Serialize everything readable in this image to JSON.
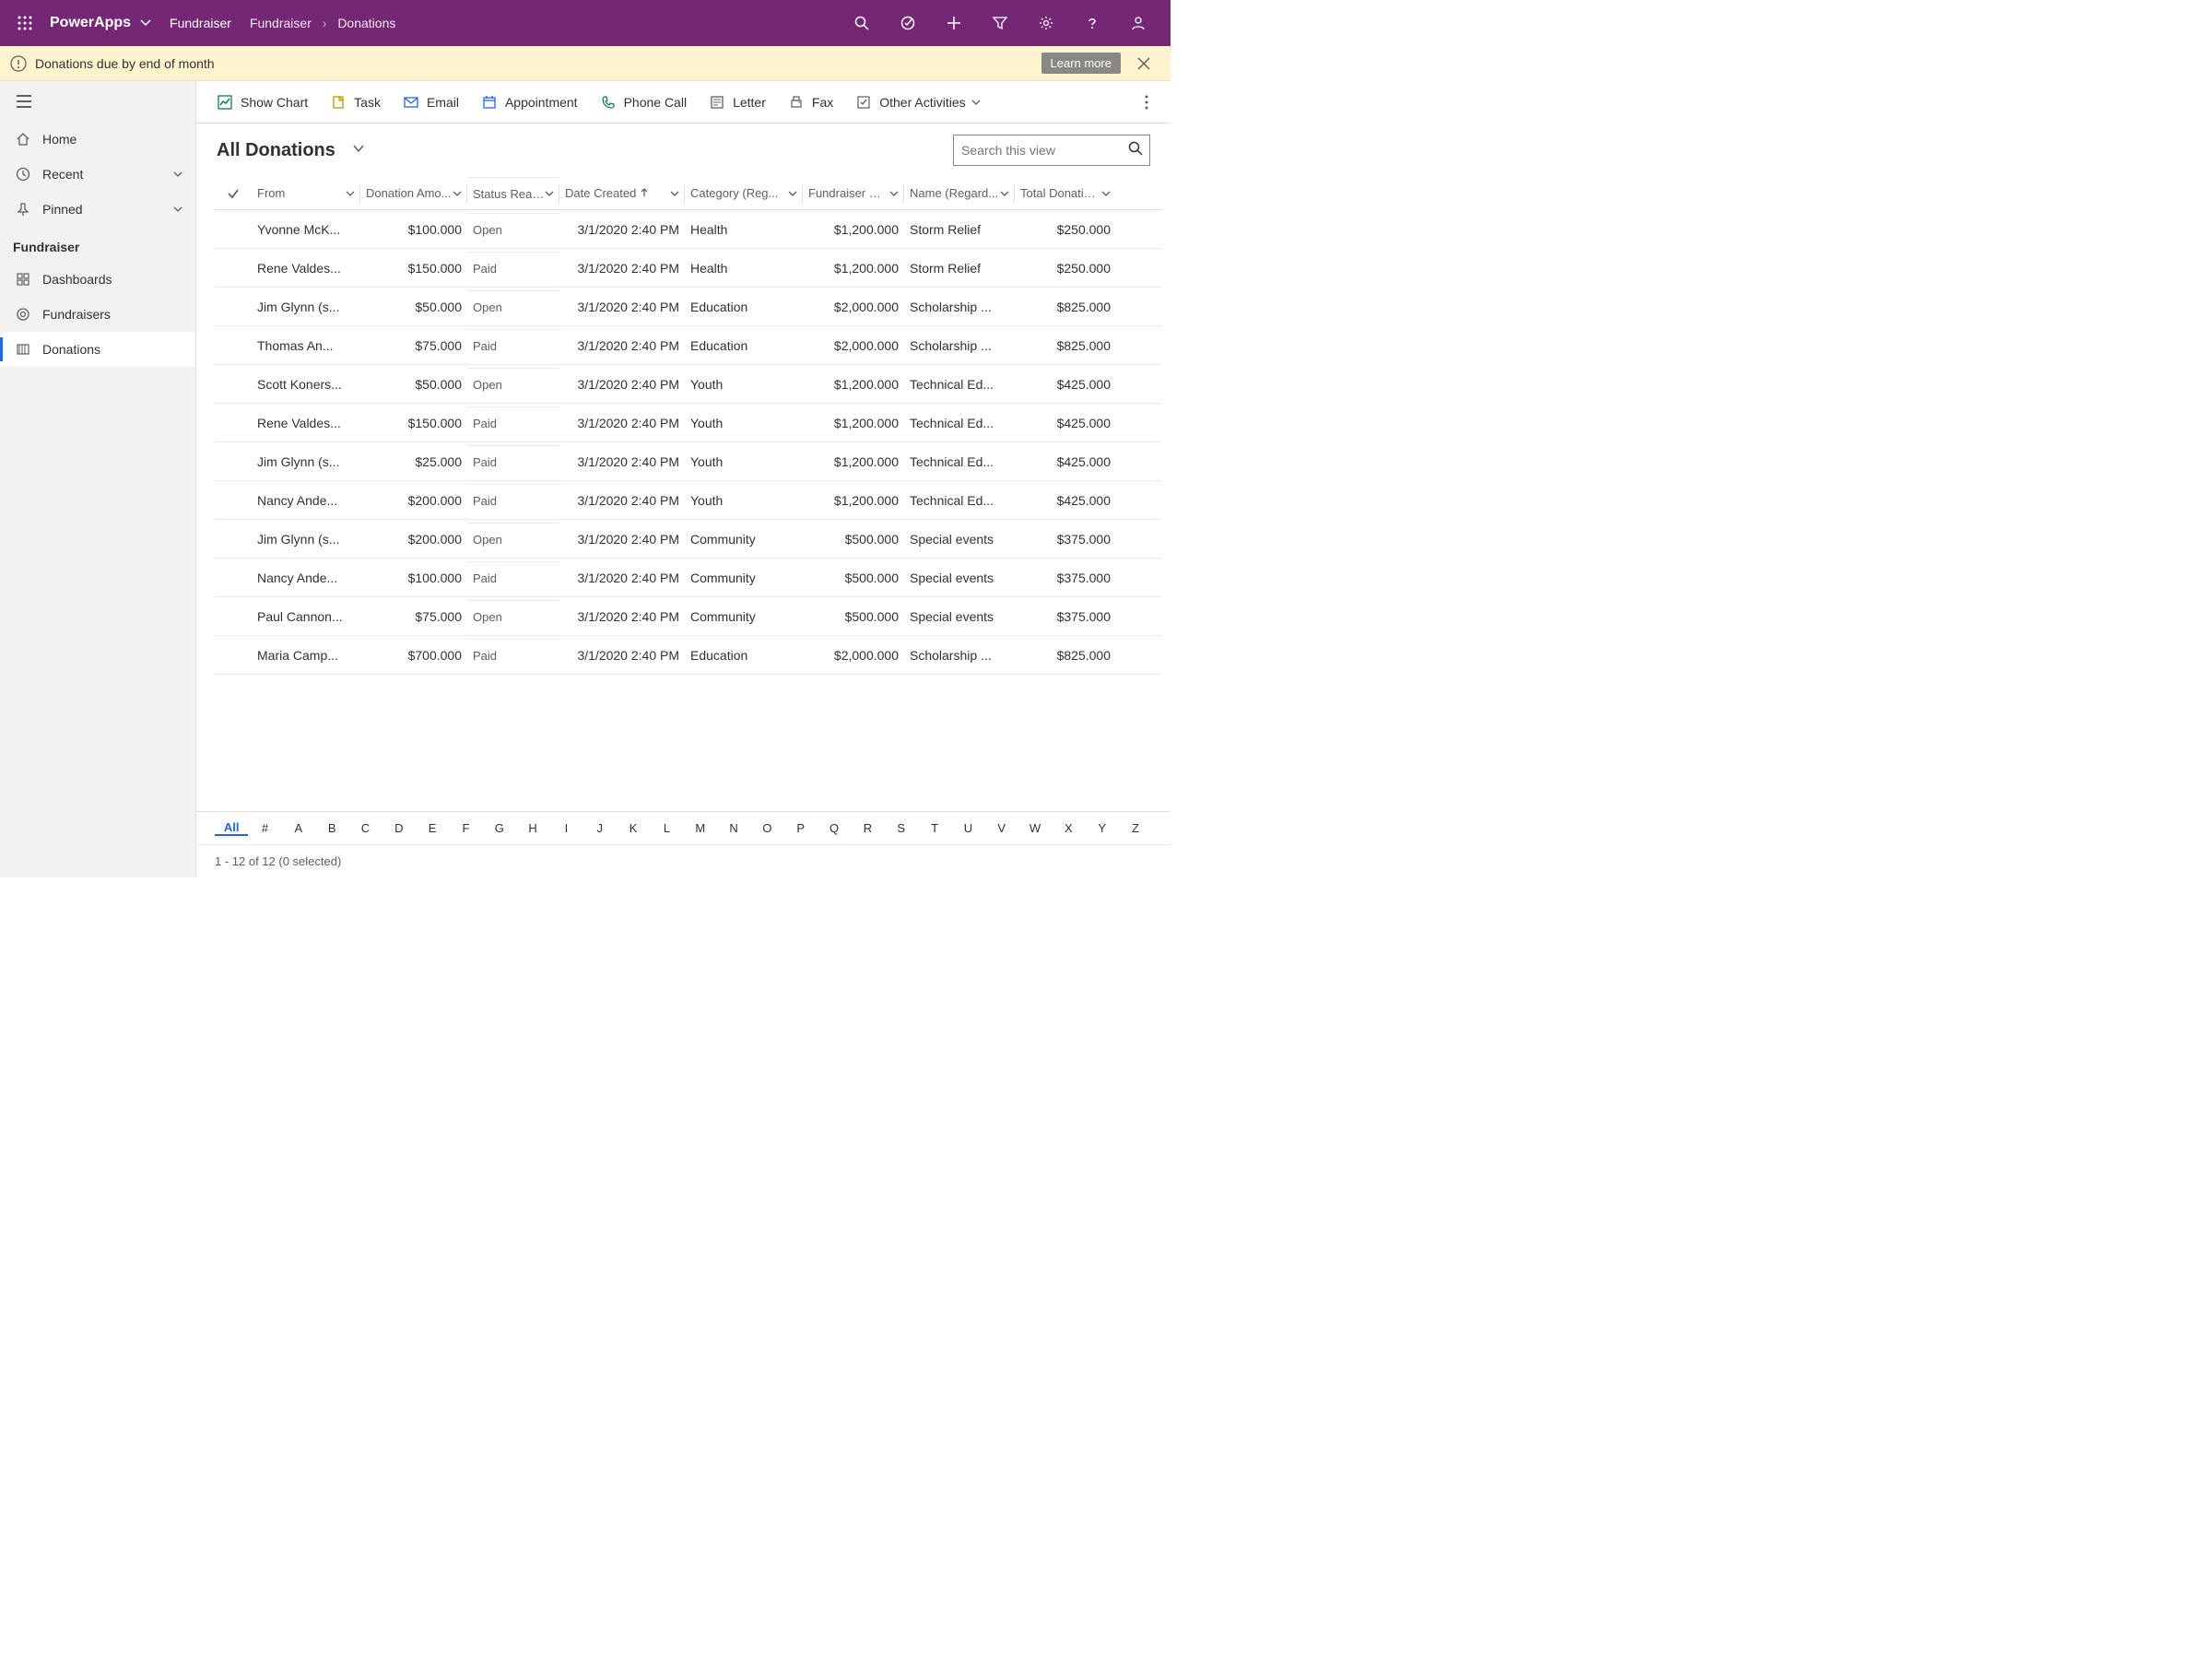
{
  "header": {
    "app_title": "PowerApps",
    "sitemap": "Fundraiser",
    "breadcrumb": [
      "Fundraiser",
      "Donations"
    ]
  },
  "notif": {
    "text": "Donations due by end of month",
    "learn_more": "Learn more"
  },
  "sidebar": {
    "top": [
      {
        "icon": "home",
        "label": "Home"
      },
      {
        "icon": "clock",
        "label": "Recent",
        "chev": true
      },
      {
        "icon": "pin",
        "label": "Pinned",
        "chev": true
      }
    ],
    "group_title": "Fundraiser",
    "items": [
      {
        "icon": "dash",
        "label": "Dashboards"
      },
      {
        "icon": "fund",
        "label": "Fundraisers"
      },
      {
        "icon": "don",
        "label": "Donations",
        "selected": true
      }
    ]
  },
  "cmdbar": [
    {
      "icon": "chart",
      "label": "Show Chart",
      "color": "#107C41"
    },
    {
      "icon": "task",
      "label": "Task",
      "color": "#C19C00"
    },
    {
      "icon": "email",
      "label": "Email",
      "color": "#2266E3"
    },
    {
      "icon": "appt",
      "label": "Appointment",
      "color": "#2266E3"
    },
    {
      "icon": "phone",
      "label": "Phone Call",
      "color": "#107C41"
    },
    {
      "icon": "letter",
      "label": "Letter",
      "color": "#605e5c"
    },
    {
      "icon": "fax",
      "label": "Fax",
      "color": "#605e5c"
    },
    {
      "icon": "other",
      "label": "Other Activities",
      "color": "#605e5c",
      "chev": true
    }
  ],
  "view": {
    "title": "All Donations",
    "search_placeholder": "Search this view"
  },
  "columns": [
    {
      "key": "from",
      "label": "From"
    },
    {
      "key": "amount",
      "label": "Donation Amo..."
    },
    {
      "key": "status",
      "label": "Status Reason"
    },
    {
      "key": "date",
      "label": "Date Created",
      "sort": "asc"
    },
    {
      "key": "cat",
      "label": "Category (Reg..."
    },
    {
      "key": "goal",
      "label": "Fundraiser Go..."
    },
    {
      "key": "name",
      "label": "Name (Regard..."
    },
    {
      "key": "total",
      "label": "Total Donation..."
    }
  ],
  "rows": [
    {
      "from": "Yvonne McK...",
      "amount": "$100.000",
      "status": "Open",
      "date": "3/1/2020 2:40 PM",
      "cat": "Health",
      "goal": "$1,200.000",
      "name": "Storm Relief",
      "total": "$250.000"
    },
    {
      "from": "Rene Valdes...",
      "amount": "$150.000",
      "status": "Paid",
      "date": "3/1/2020 2:40 PM",
      "cat": "Health",
      "goal": "$1,200.000",
      "name": "Storm Relief",
      "total": "$250.000"
    },
    {
      "from": "Jim Glynn (s...",
      "amount": "$50.000",
      "status": "Open",
      "date": "3/1/2020 2:40 PM",
      "cat": "Education",
      "goal": "$2,000.000",
      "name": "Scholarship ...",
      "total": "$825.000"
    },
    {
      "from": "Thomas An...",
      "amount": "$75.000",
      "status": "Paid",
      "date": "3/1/2020 2:40 PM",
      "cat": "Education",
      "goal": "$2,000.000",
      "name": "Scholarship ...",
      "total": "$825.000"
    },
    {
      "from": "Scott Koners...",
      "amount": "$50.000",
      "status": "Open",
      "date": "3/1/2020 2:40 PM",
      "cat": "Youth",
      "goal": "$1,200.000",
      "name": "Technical Ed...",
      "total": "$425.000"
    },
    {
      "from": "Rene Valdes...",
      "amount": "$150.000",
      "status": "Paid",
      "date": "3/1/2020 2:40 PM",
      "cat": "Youth",
      "goal": "$1,200.000",
      "name": "Technical Ed...",
      "total": "$425.000"
    },
    {
      "from": "Jim Glynn (s...",
      "amount": "$25.000",
      "status": "Paid",
      "date": "3/1/2020 2:40 PM",
      "cat": "Youth",
      "goal": "$1,200.000",
      "name": "Technical Ed...",
      "total": "$425.000"
    },
    {
      "from": "Nancy Ande...",
      "amount": "$200.000",
      "status": "Paid",
      "date": "3/1/2020 2:40 PM",
      "cat": "Youth",
      "goal": "$1,200.000",
      "name": "Technical Ed...",
      "total": "$425.000"
    },
    {
      "from": "Jim Glynn (s...",
      "amount": "$200.000",
      "status": "Open",
      "date": "3/1/2020 2:40 PM",
      "cat": "Community",
      "goal": "$500.000",
      "name": "Special events",
      "total": "$375.000"
    },
    {
      "from": "Nancy Ande...",
      "amount": "$100.000",
      "status": "Paid",
      "date": "3/1/2020 2:40 PM",
      "cat": "Community",
      "goal": "$500.000",
      "name": "Special events",
      "total": "$375.000"
    },
    {
      "from": "Paul Cannon...",
      "amount": "$75.000",
      "status": "Open",
      "date": "3/1/2020 2:40 PM",
      "cat": "Community",
      "goal": "$500.000",
      "name": "Special events",
      "total": "$375.000"
    },
    {
      "from": "Maria Camp...",
      "amount": "$700.000",
      "status": "Paid",
      "date": "3/1/2020 2:40 PM",
      "cat": "Education",
      "goal": "$2,000.000",
      "name": "Scholarship ...",
      "total": "$825.000"
    }
  ],
  "alpha": [
    "All",
    "#",
    "A",
    "B",
    "C",
    "D",
    "E",
    "F",
    "G",
    "H",
    "I",
    "J",
    "K",
    "L",
    "M",
    "N",
    "O",
    "P",
    "Q",
    "R",
    "S",
    "T",
    "U",
    "V",
    "W",
    "X",
    "Y",
    "Z"
  ],
  "alpha_selected": "All",
  "status_text": "1 - 12 of 12 (0 selected)"
}
